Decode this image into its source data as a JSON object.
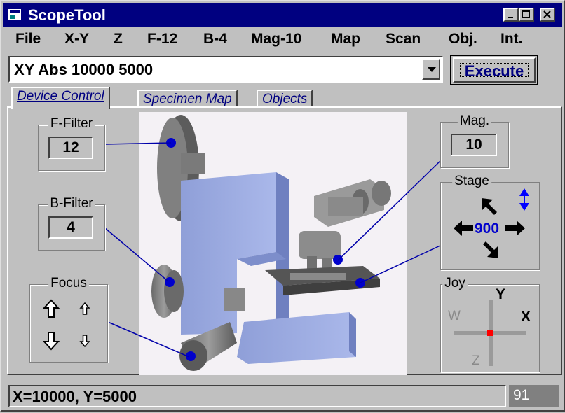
{
  "window": {
    "title": "ScopeTool"
  },
  "menu": [
    "File",
    "X-Y",
    "Z",
    "F-12",
    "B-4",
    "Mag-10",
    "Map",
    "Scan",
    "Obj.",
    "Int."
  ],
  "command": {
    "value": "XY Abs 10000 5000",
    "execute_label": "Execute"
  },
  "tabs": [
    "Device Control",
    "Specimen Map",
    "Objects"
  ],
  "ffilter": {
    "title": "F-Filter",
    "value": "12"
  },
  "bfilter": {
    "title": "B-Filter",
    "value": "4"
  },
  "focus": {
    "title": "Focus"
  },
  "mag": {
    "title": "Mag.",
    "value": "10"
  },
  "stage": {
    "title": "Stage",
    "step": "900"
  },
  "joy": {
    "title": "Joy",
    "y": "Y",
    "x": "X",
    "w": "W",
    "z": "Z"
  },
  "status": {
    "text": "X=10000, Y=5000",
    "number": "91"
  },
  "colors": {
    "titlebar": "#000080",
    "face": "#c0c0c0",
    "stage_arrows": "#0000ff",
    "joy_dot": "#ff0000"
  }
}
